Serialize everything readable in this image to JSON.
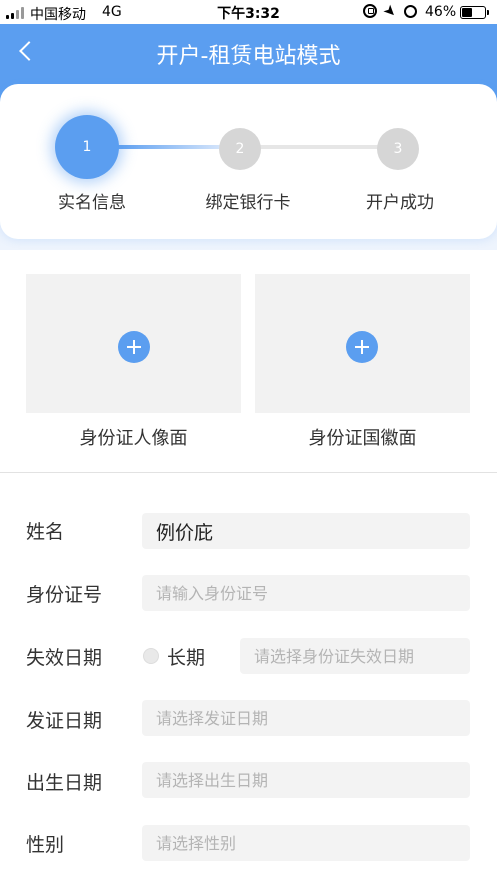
{
  "status_bar": {
    "carrier": "中国移动",
    "network": "4G",
    "time": "下午3:32",
    "battery_percent": "46%",
    "battery_level": 0.46,
    "icons": [
      "signal-icon",
      "rotation-lock-icon",
      "location-icon",
      "alarm-icon",
      "battery-icon"
    ]
  },
  "header": {
    "title": "开户-租赁电站模式",
    "back_icon": "chevron-left-icon"
  },
  "steps": [
    {
      "number": "1",
      "label": "实名信息",
      "state": "active"
    },
    {
      "number": "2",
      "label": "绑定银行卡",
      "state": "pending"
    },
    {
      "number": "3",
      "label": "开户成功",
      "state": "pending"
    }
  ],
  "upload": {
    "front_label": "身份证人像面",
    "back_label": "身份证国徽面",
    "icon": "plus-icon"
  },
  "form": {
    "name": {
      "label": "姓名",
      "value": "例价庇"
    },
    "id_number": {
      "label": "身份证号",
      "placeholder": "请输入身份证号"
    },
    "expiry": {
      "label": "失效日期",
      "long_term_label": "长期",
      "placeholder": "请选择身份证失效日期"
    },
    "issue_date": {
      "label": "发证日期",
      "placeholder": "请选择发证日期"
    },
    "birth_date": {
      "label": "出生日期",
      "placeholder": "请选择出生日期"
    },
    "gender": {
      "label": "性别",
      "placeholder": "请选择性别"
    }
  },
  "colors": {
    "accent": "#5b9ef0",
    "step_pending": "#d6d6d6",
    "field_bg": "#f3f3f3",
    "upload_bg": "#f2f2f2"
  }
}
